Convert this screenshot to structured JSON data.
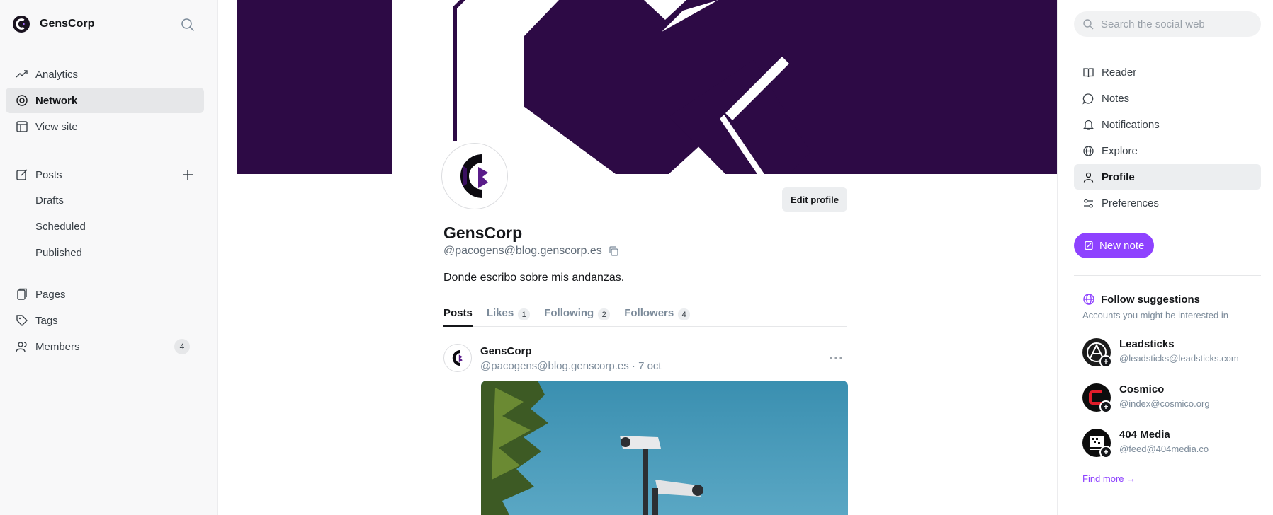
{
  "sidebar": {
    "brand": "GensCorp",
    "nav": [
      {
        "label": "Analytics",
        "icon": "trend-icon"
      },
      {
        "label": "Network",
        "icon": "network-icon"
      },
      {
        "label": "View site",
        "icon": "layout-icon"
      }
    ],
    "posts": {
      "label": "Posts",
      "sub": [
        "Drafts",
        "Scheduled",
        "Published"
      ]
    },
    "bottom": [
      {
        "label": "Pages",
        "icon": "pages-icon"
      },
      {
        "label": "Tags",
        "icon": "tag-icon"
      },
      {
        "label": "Members",
        "icon": "members-icon",
        "count": "4"
      }
    ]
  },
  "profile": {
    "name": "GensCorp",
    "handle": "@pacogens@blog.genscorp.es",
    "bio": "Donde escribo sobre mis andanzas.",
    "edit_label": "Edit profile",
    "tabs": [
      {
        "label": "Posts",
        "count": ""
      },
      {
        "label": "Likes",
        "count": "1"
      },
      {
        "label": "Following",
        "count": "2"
      },
      {
        "label": "Followers",
        "count": "4"
      }
    ]
  },
  "post": {
    "author": "GensCorp",
    "meta": "@pacogens@blog.genscorp.es · 7 oct"
  },
  "right": {
    "search_placeholder": "Search the social web",
    "nav": [
      {
        "label": "Reader",
        "icon": "book-icon"
      },
      {
        "label": "Notes",
        "icon": "chat-bubble-icon"
      },
      {
        "label": "Notifications",
        "icon": "bell-icon"
      },
      {
        "label": "Explore",
        "icon": "globe-icon"
      },
      {
        "label": "Profile",
        "icon": "user-icon"
      },
      {
        "label": "Preferences",
        "icon": "sliders-icon"
      }
    ],
    "new_note": "New note",
    "follow": {
      "title": "Follow suggestions",
      "subtitle": "Accounts you might be interested in",
      "items": [
        {
          "name": "Leadsticks",
          "handle": "@leadsticks@leadsticks.com"
        },
        {
          "name": "Cosmico",
          "handle": "@index@cosmico.org"
        },
        {
          "name": "404 Media",
          "handle": "@feed@404media.co"
        }
      ],
      "find_more": "Find more →"
    }
  },
  "colors": {
    "accent": "#8e42ff",
    "cover": "#2d0a45"
  }
}
